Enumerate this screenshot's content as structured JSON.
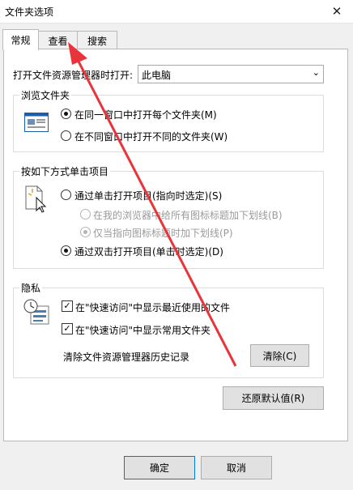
{
  "window": {
    "title": "文件夹选项",
    "close_glyph": "✕"
  },
  "tabs": [
    {
      "label": "常规"
    },
    {
      "label": "查看"
    },
    {
      "label": "搜索"
    }
  ],
  "open_explorer": {
    "label": "打开文件资源管理器时打开:",
    "value": "此电脑",
    "arrow": "⌄"
  },
  "browse_folders": {
    "legend": "浏览文件夹",
    "options": [
      {
        "label": "在同一窗口中打开每个文件夹(M)",
        "checked": true
      },
      {
        "label": "在不同窗口中打开不同的文件夹(W)",
        "checked": false
      }
    ]
  },
  "click_items": {
    "legend": "按如下方式单击项目",
    "single_click": "通过单击打开项目(指向时选定)(S)",
    "underline_always": "在我的浏览器中给所有图标标题加下划线(B)",
    "underline_point": "仅当指向图标标题时加下划线(P)",
    "double_click": "通过双击打开项目(单击时选定)(D)"
  },
  "privacy": {
    "legend": "隐私",
    "recent_files": "在\"快速访问\"中显示最近使用的文件",
    "frequent_folders": "在\"快速访问\"中显示常用文件夹",
    "clear_label": "清除文件资源管理器历史记录",
    "clear_button": "清除(C)",
    "checkmark": "✓"
  },
  "restore_defaults": "还原默认值(R)",
  "footer": {
    "ok": "确定",
    "cancel": "取消"
  },
  "colors": {
    "annotation_arrow": "#e8343a",
    "default_button_border": "#0078d7"
  }
}
